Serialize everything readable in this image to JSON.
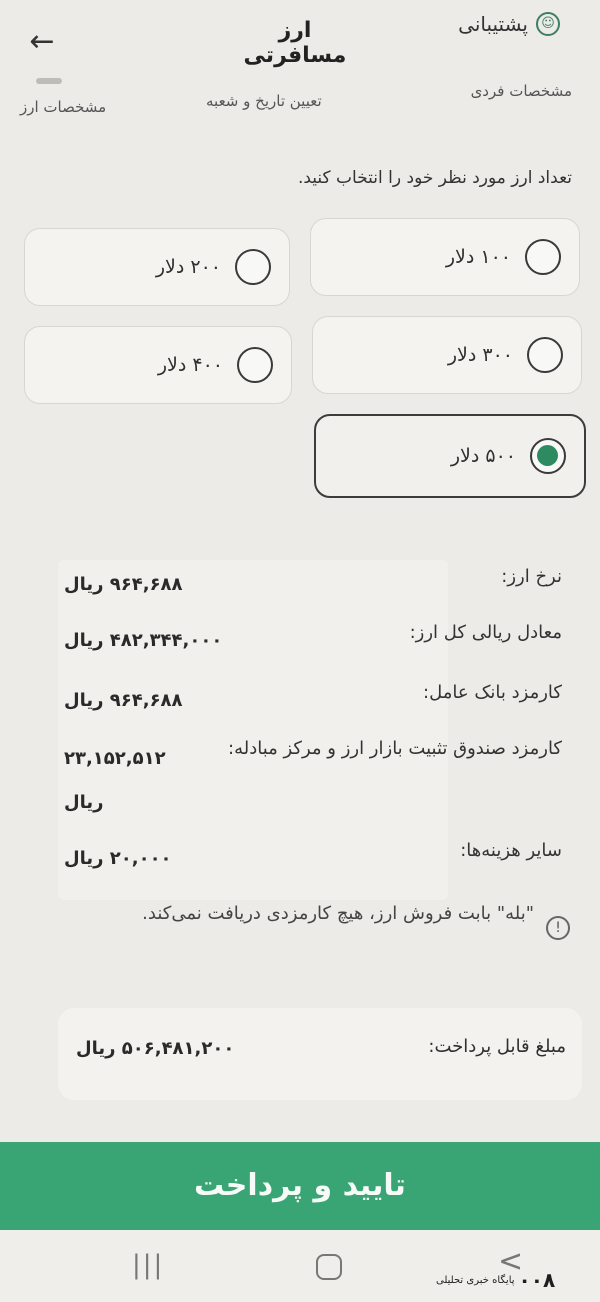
{
  "header": {
    "title": "ارز مسافرتی",
    "support_label": "پشتیبانی",
    "back_icon": "arrow-left-icon",
    "support_icon": "headset-icon"
  },
  "steps": [
    {
      "label": "مشخصات فردی"
    },
    {
      "label": "تعیین تاریخ و شعبه"
    },
    {
      "label": "مشخصات ارز"
    }
  ],
  "prompt": "تعداد ارز مورد نظر خود را انتخاب کنید.",
  "options": [
    {
      "label": "۱۰۰ دلار",
      "selected": false
    },
    {
      "label": "۲۰۰ دلار",
      "selected": false
    },
    {
      "label": "۳۰۰ دلار",
      "selected": false
    },
    {
      "label": "۴۰۰ دلار",
      "selected": false
    },
    {
      "label": "۵۰۰ دلار",
      "selected": true
    }
  ],
  "summary": [
    {
      "label": "نرخ ارز:",
      "value": "۹۶۴,۶۸۸ ریال"
    },
    {
      "label": "معادل ریالی کل ارز:",
      "value": "۴۸۲,۳۴۴,۰۰۰ ریال"
    },
    {
      "label": "کارمزد بانک عامل:",
      "value": "۹۶۴,۶۸۸ ریال"
    },
    {
      "label": "کارمزد صندوق تثبیت بازار ارز و مرکز مبادله:",
      "value": "۲۳,۱۵۲,۵۱۲",
      "value_unit": "ریال"
    },
    {
      "label": "سایر هزینه‌ها:",
      "value": "۲۰,۰۰۰ ریال"
    }
  ],
  "note": "\"بله\" بابت فروش ارز، هیچ کارمزدی دریافت نمی‌کند.",
  "payable": {
    "label": "مبلغ قابل پرداخت:",
    "value": "۵۰۶,۴۸۱,۲۰۰ ریال"
  },
  "confirm_label": "تایید و پرداخت",
  "navbar": {
    "recent": "|||",
    "back": "<"
  },
  "watermark": {
    "logo": "۰۰۸",
    "text": "پایگاه خبری تحلیلی"
  },
  "colors": {
    "accent": "#3aa574",
    "radio_selected": "#2e8a61",
    "background": "#ecebe8"
  }
}
